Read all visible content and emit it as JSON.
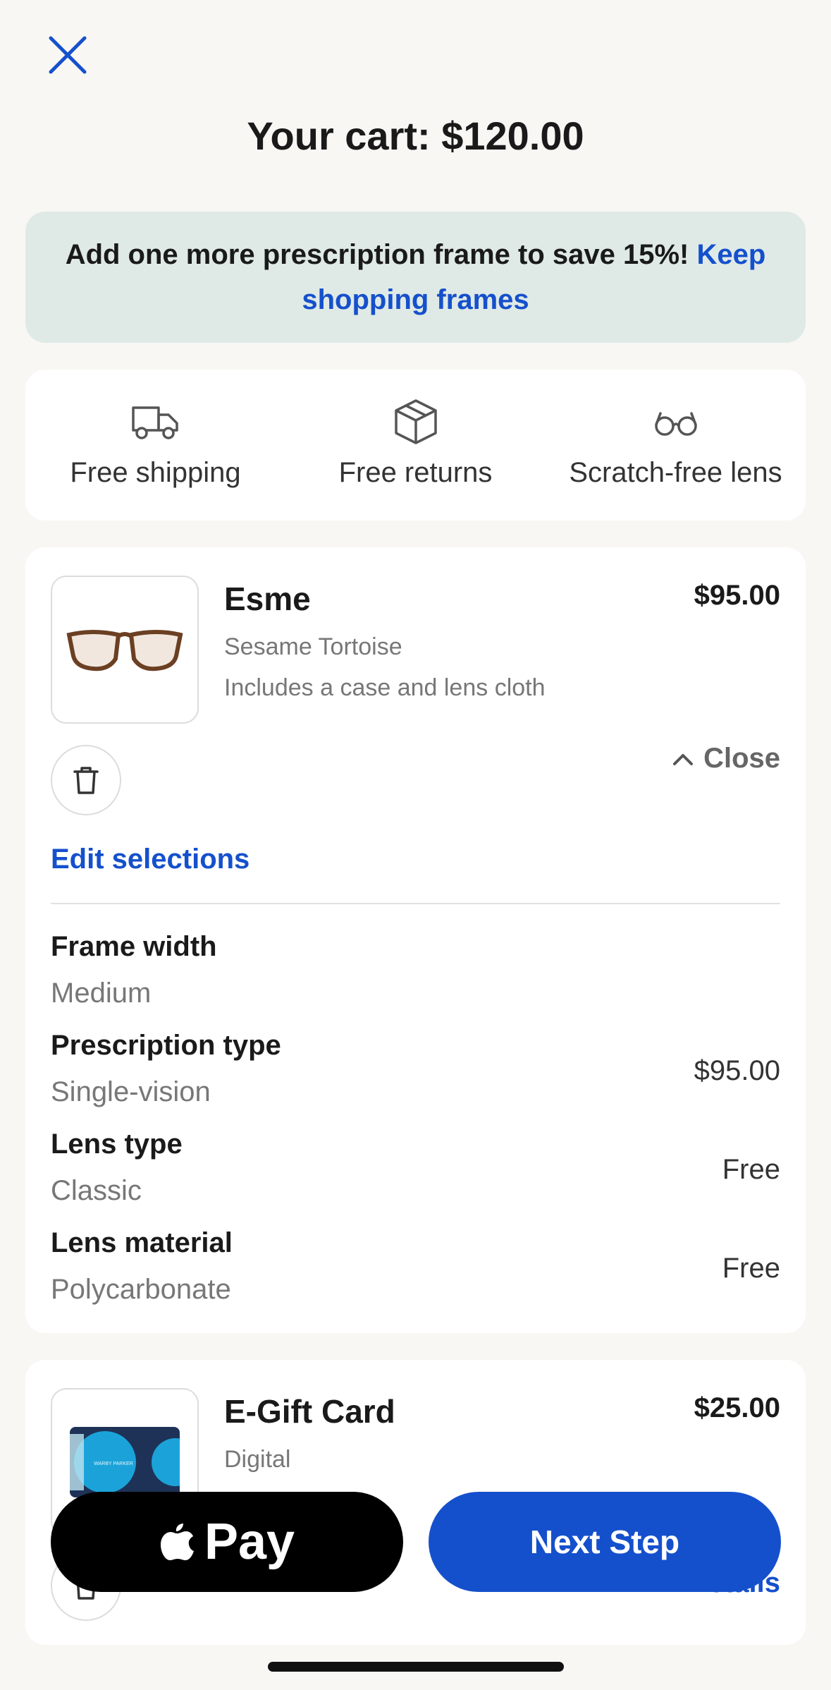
{
  "header": {
    "title": "Your cart: $120.00"
  },
  "promo": {
    "text": "Add one more prescription frame to save 15%! ",
    "link": "Keep shopping frames"
  },
  "perks": [
    {
      "icon": "truck-icon",
      "label": "Free shipping"
    },
    {
      "icon": "box-icon",
      "label": "Free returns"
    },
    {
      "icon": "glasses-icon",
      "label": "Scratch-free lens"
    }
  ],
  "item1": {
    "name": "Esme",
    "price": "$95.00",
    "variant": "Sesame Tortoise",
    "note": "Includes a case and lens cloth",
    "close_label": "Close",
    "edit_label": "Edit selections",
    "specs": [
      {
        "label": "Frame width",
        "value": "Medium",
        "price": ""
      },
      {
        "label": "Prescription type",
        "value": "Single-vision",
        "price": "$95.00"
      },
      {
        "label": "Lens type",
        "value": "Classic",
        "price": "Free"
      },
      {
        "label": "Lens material",
        "value": "Polycarbonate",
        "price": "Free"
      }
    ]
  },
  "item2": {
    "name": "E-Gift Card",
    "price": "$25.00",
    "variant": "Digital",
    "card_brand": "WARBY PARKER",
    "details_label": "Details"
  },
  "footer": {
    "apple_pay_label": "Pay",
    "next_label": "Next Step"
  },
  "colors": {
    "accent": "#1550cc",
    "promo_bg": "#dfeae6",
    "page_bg": "#f8f7f4"
  }
}
